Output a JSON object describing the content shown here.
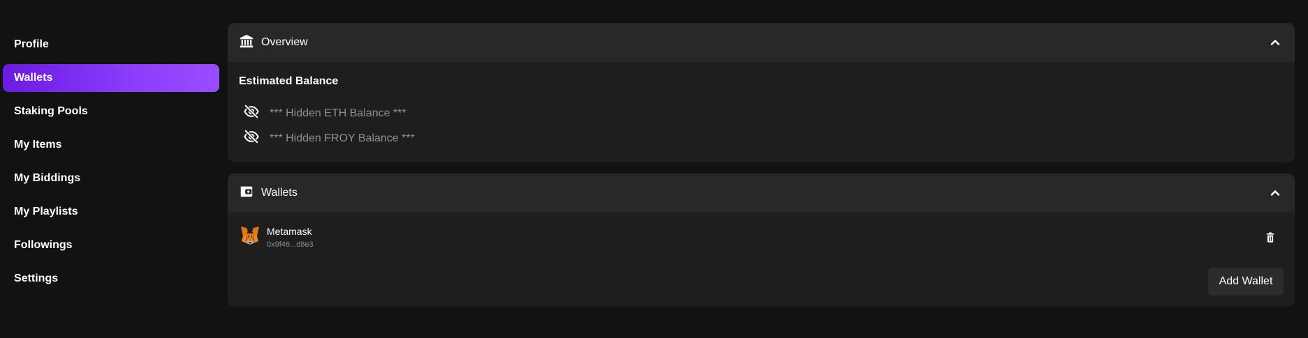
{
  "sidebar": {
    "items": [
      {
        "label": "Profile",
        "active": false
      },
      {
        "label": "Wallets",
        "active": true
      },
      {
        "label": "Staking Pools",
        "active": false
      },
      {
        "label": "My Items",
        "active": false
      },
      {
        "label": "My Biddings",
        "active": false
      },
      {
        "label": "My Playlists",
        "active": false
      },
      {
        "label": "Followings",
        "active": false
      },
      {
        "label": "Settings",
        "active": false
      }
    ]
  },
  "overview": {
    "title": "Overview",
    "icon": "bank-icon",
    "estimated_balance_label": "Estimated Balance",
    "balances": [
      {
        "text": "*** Hidden ETH Balance ***",
        "icon": "eye-off-icon"
      },
      {
        "text": "*** Hidden FROY Balance ***",
        "icon": "eye-off-icon"
      }
    ]
  },
  "wallets": {
    "title": "Wallets",
    "icon": "wallet-icon",
    "items": [
      {
        "name": "Metamask",
        "address": "0x9f46...d8e3",
        "icon": "metamask-fox-icon"
      }
    ],
    "add_label": "Add Wallet"
  },
  "colors": {
    "background": "#121212",
    "panel": "#1e1e1f",
    "panel_header": "#28282a",
    "accent_start": "#6a1be0",
    "accent_end": "#9a4dff",
    "muted_text": "#8f8f94"
  }
}
